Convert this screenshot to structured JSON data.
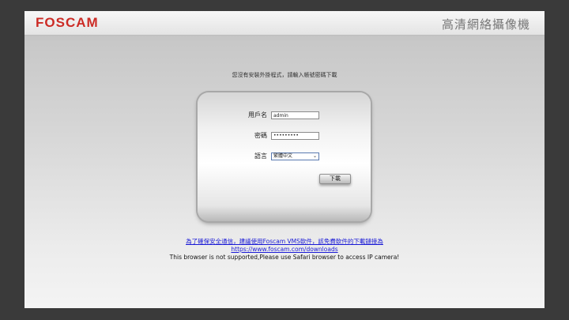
{
  "header": {
    "logo": "FOSCAM",
    "title": "高清網絡攝像機"
  },
  "notice": "您沒有安裝外掛程式，請輸入帳號密碼下載",
  "form": {
    "username_label": "用戶名",
    "username_value": "admin",
    "password_label": "密碼",
    "password_value": "•••••••••",
    "language_label": "語言",
    "language_value": "繁體中文",
    "download_button": "下載"
  },
  "footer": {
    "vms_link": "為了確保安全通信，建議使用Foscam VMS軟件，該免費軟件的下載鏈接為",
    "url_link": "https://www.foscam.com/downloads",
    "browser_notice": "This browser is not supported,Please use Safari browser to access IP camera!"
  }
}
